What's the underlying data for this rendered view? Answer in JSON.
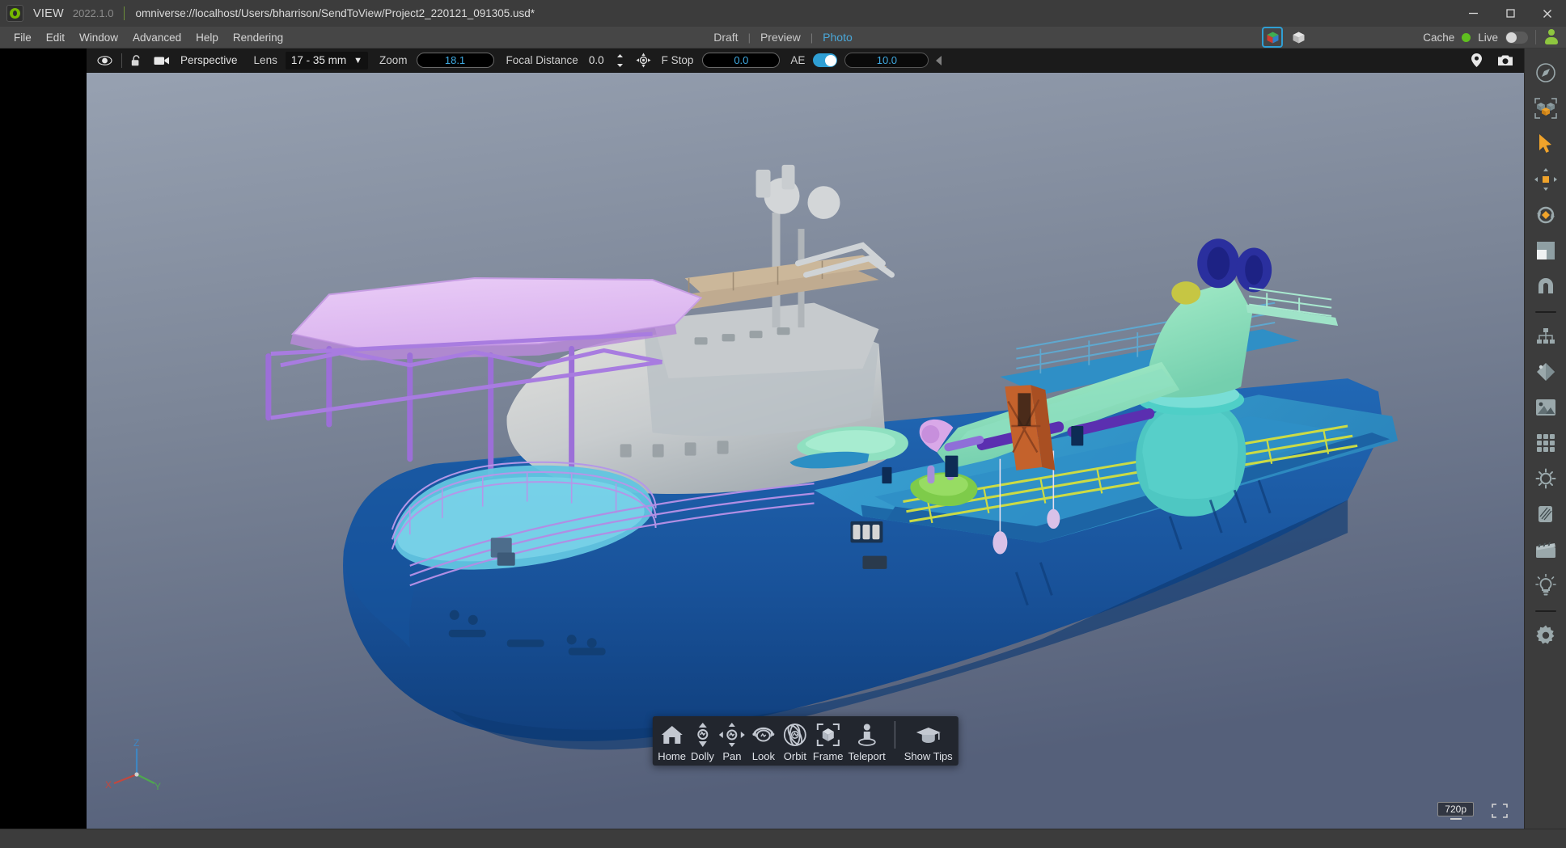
{
  "titlebar": {
    "logo_icon": "omniverse-logo-icon",
    "app_name": "VIEW",
    "version": "2022.1.0",
    "document_path": "omniverse://localhost/Users/bharrison/SendToView/Project2_220121_091305.usd*",
    "minimize_glyph": "–",
    "maximize_glyph": "☐",
    "close_glyph": "✕"
  },
  "menubar": {
    "items": [
      {
        "label": "File"
      },
      {
        "label": "Edit"
      },
      {
        "label": "Window"
      },
      {
        "label": "Advanced"
      },
      {
        "label": "Help"
      },
      {
        "label": "Rendering"
      }
    ],
    "render_tabs": [
      {
        "label": "Draft",
        "active": false
      },
      {
        "label": "Preview",
        "active": false
      },
      {
        "label": "Photo",
        "active": true
      }
    ],
    "tab_separator": "|",
    "mode_buttons": [
      {
        "icon": "colored-cube-icon",
        "selected": true
      },
      {
        "icon": "gray-cube-icon",
        "selected": false
      }
    ],
    "status": {
      "cache_label": "Cache",
      "cache_state": "on",
      "live_label": "Live",
      "live_state": "off",
      "user_icon": "user-avatar-icon"
    }
  },
  "viewport_toolbar": {
    "eye_icon": "eye-visibility-icon",
    "lock_icon": "lock-open-icon",
    "camera_icon": "camera-icon",
    "camera_name": "Perspective",
    "lens_label": "Lens",
    "lens_value": "17 - 35 mm",
    "lens_caret": "▼",
    "zoom_label": "Zoom",
    "zoom_value": "18.1",
    "focal_distance_label": "Focal Distance",
    "focal_distance_value": "0.0",
    "stepper_icon": "up-down-stepper-icon",
    "focus_target_icon": "focus-target-icon",
    "fstop_label": "F Stop",
    "fstop_value": "0.0",
    "ae_label": "AE",
    "ae_enabled": true,
    "exposure_value": "10.0",
    "collapse_icon": "collapse-left-icon",
    "pin_icon": "location-pin-icon",
    "snapshot_icon": "camera-snapshot-icon"
  },
  "nav_toolbar": {
    "items": [
      {
        "label": "Home",
        "icon": "home-icon"
      },
      {
        "label": "Dolly",
        "icon": "dolly-icon"
      },
      {
        "label": "Pan",
        "icon": "pan-icon"
      },
      {
        "label": "Look",
        "icon": "look-icon"
      },
      {
        "label": "Orbit",
        "icon": "orbit-icon"
      },
      {
        "label": "Frame",
        "icon": "frame-icon"
      },
      {
        "label": "Teleport",
        "icon": "teleport-icon"
      }
    ],
    "tips": {
      "label": "Show Tips",
      "icon": "graduation-cap-icon"
    }
  },
  "viewport_overlay": {
    "axis_gizmo": {
      "x_label": "X",
      "y_label": "Y",
      "z_label": "Z",
      "x_color": "#c2483f",
      "y_color": "#4fa84f",
      "z_color": "#3f86c2"
    },
    "resolution": "720p",
    "fullscreen_icon": "fullscreen-icon"
  },
  "right_rail": {
    "items": [
      {
        "icon": "compass-navigation-icon"
      },
      {
        "icon": "selection-group-icon"
      },
      {
        "icon": "select-cursor-icon"
      },
      {
        "icon": "move-translate-icon"
      },
      {
        "icon": "rotate-icon"
      },
      {
        "icon": "scale-icon"
      },
      {
        "icon": "snap-magnet-icon"
      }
    ],
    "items2": [
      {
        "icon": "hierarchy-tree-icon"
      },
      {
        "icon": "paint-material-icon"
      },
      {
        "icon": "image-texture-icon"
      },
      {
        "icon": "grid-apps-icon"
      },
      {
        "icon": "sun-environment-icon"
      },
      {
        "icon": "material-swatch-icon"
      },
      {
        "icon": "movie-clapper-icon"
      },
      {
        "icon": "light-bulb-icon"
      }
    ],
    "items3": [
      {
        "icon": "settings-gear-icon"
      }
    ]
  },
  "scene": {
    "description": "3D rendered offshore construction vessel on a blue-gray gradient background",
    "background_top": "#8a94a6",
    "background_bottom": "#5c6779",
    "hull_color": "#1a5fa8",
    "deck_color": "#2d93c9",
    "helideck_color": "#ddb9ee",
    "superstructure_color": "#cfd2d4",
    "crane_color": "#8fe0c0",
    "railing_color": "#c4d84a",
    "tower_color": "#c4622c",
    "winch_color": "#2a2f9e"
  }
}
